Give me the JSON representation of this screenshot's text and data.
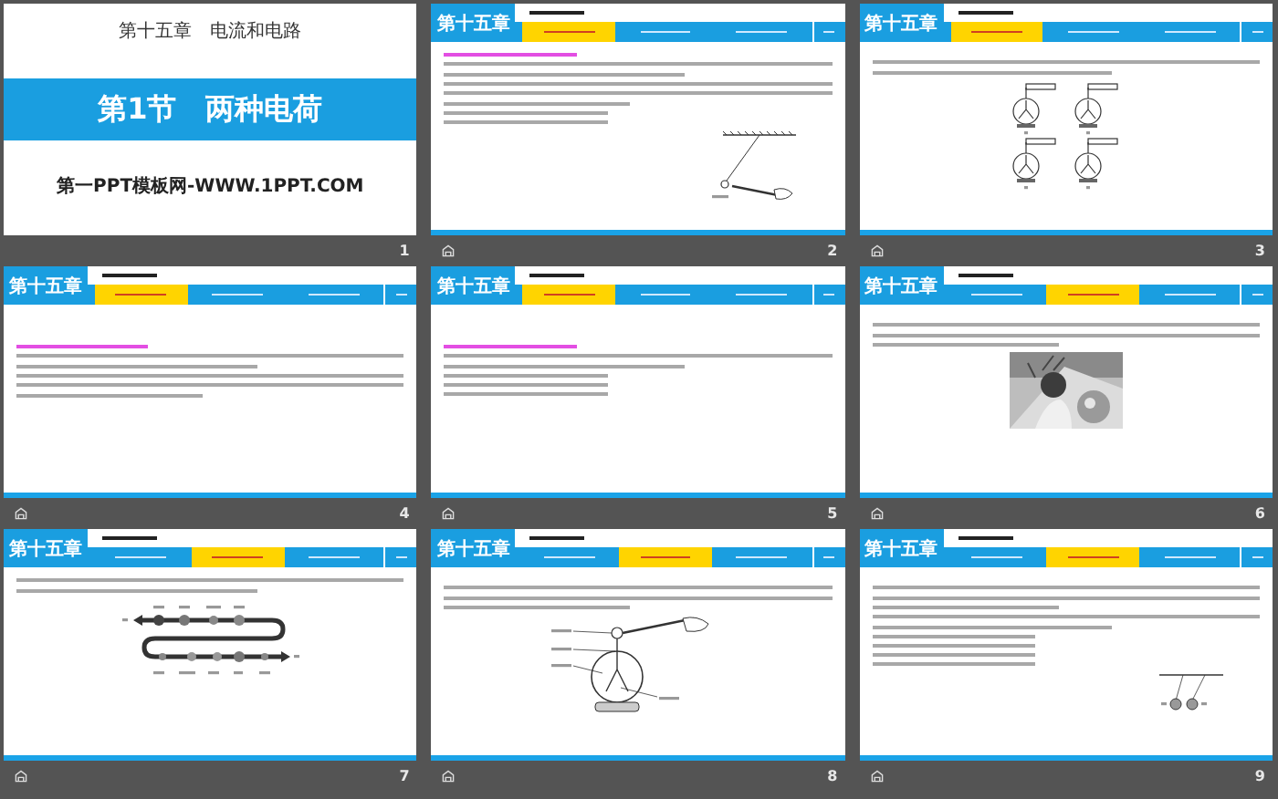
{
  "slides": [
    {
      "number": "1",
      "kind": "title",
      "animated": false,
      "chapter": "第十五章　电流和电路",
      "title": "第1节　两种电荷",
      "footer": "第一PPT模板网-WWW.1PPT.COM"
    },
    {
      "number": "2",
      "kind": "content",
      "animated": true,
      "header": {
        "chapter": "第十五章",
        "tabs": [
          {
            "selected": true
          },
          {
            "selected": false
          },
          {
            "selected": false
          },
          {
            "selected": false
          }
        ]
      },
      "blocks": [
        {
          "kind": "heading"
        },
        {
          "kind": "paragraph"
        },
        {
          "kind": "long-paragraph"
        },
        {
          "kind": "option"
        },
        {
          "kind": "option"
        }
      ],
      "figure": {
        "kind": "hanging-ball"
      }
    },
    {
      "number": "3",
      "kind": "content",
      "animated": true,
      "header": {
        "chapter": "第十五章",
        "tabs": [
          {
            "selected": true
          },
          {
            "selected": false
          },
          {
            "selected": false
          },
          {
            "selected": false
          }
        ]
      },
      "blocks": [
        {
          "kind": "paragraph"
        }
      ],
      "figure": {
        "kind": "electroscopes"
      }
    },
    {
      "number": "4",
      "kind": "content",
      "animated": true,
      "header": {
        "chapter": "第十五章",
        "tabs": [
          {
            "selected": true
          },
          {
            "selected": false
          },
          {
            "selected": false
          },
          {
            "selected": false
          }
        ]
      },
      "blocks": [
        {
          "kind": "heading"
        },
        {
          "kind": "paragraph"
        },
        {
          "kind": "long-paragraph"
        }
      ]
    },
    {
      "number": "5",
      "kind": "content",
      "animated": true,
      "header": {
        "chapter": "第十五章",
        "tabs": [
          {
            "selected": true
          },
          {
            "selected": false
          },
          {
            "selected": false
          },
          {
            "selected": false
          }
        ]
      },
      "blocks": [
        {
          "kind": "heading"
        },
        {
          "kind": "paragraph"
        },
        {
          "kind": "option"
        },
        {
          "kind": "option"
        },
        {
          "kind": "option"
        }
      ]
    },
    {
      "number": "6",
      "kind": "content",
      "animated": true,
      "header": {
        "chapter": "第十五章",
        "tabs": [
          {
            "selected": false
          },
          {
            "selected": true
          },
          {
            "selected": false
          },
          {
            "selected": false
          }
        ]
      },
      "blocks": [
        {
          "kind": "long-paragraph"
        }
      ]
    },
    {
      "number": "7",
      "kind": "content",
      "animated": true,
      "header": {
        "chapter": "第十五章",
        "tabs": [
          {
            "selected": false
          },
          {
            "selected": true
          },
          {
            "selected": false
          },
          {
            "selected": false
          }
        ]
      },
      "blocks": [
        {
          "kind": "paragraph"
        }
      ],
      "figure": {
        "kind": "ranking"
      }
    },
    {
      "number": "8",
      "kind": "content",
      "animated": true,
      "header": {
        "chapter": "第十五章",
        "tabs": [
          {
            "selected": false
          },
          {
            "selected": true
          },
          {
            "selected": false
          },
          {
            "selected": false
          }
        ]
      },
      "blocks": [
        {
          "kind": "long-paragraph"
        }
      ],
      "figure": {
        "kind": "electroscope-hand"
      }
    },
    {
      "number": "9",
      "kind": "content",
      "animated": true,
      "header": {
        "chapter": "第十五章",
        "tabs": [
          {
            "selected": false
          },
          {
            "selected": true
          },
          {
            "selected": false
          },
          {
            "selected": false
          }
        ]
      },
      "blocks": [
        {
          "kind": "long-paragraph"
        },
        {
          "kind": "paragraph"
        },
        {
          "kind": "option"
        },
        {
          "kind": "option"
        },
        {
          "kind": "option"
        },
        {
          "kind": "option"
        }
      ],
      "figure": {
        "kind": "two-balls"
      }
    }
  ]
}
